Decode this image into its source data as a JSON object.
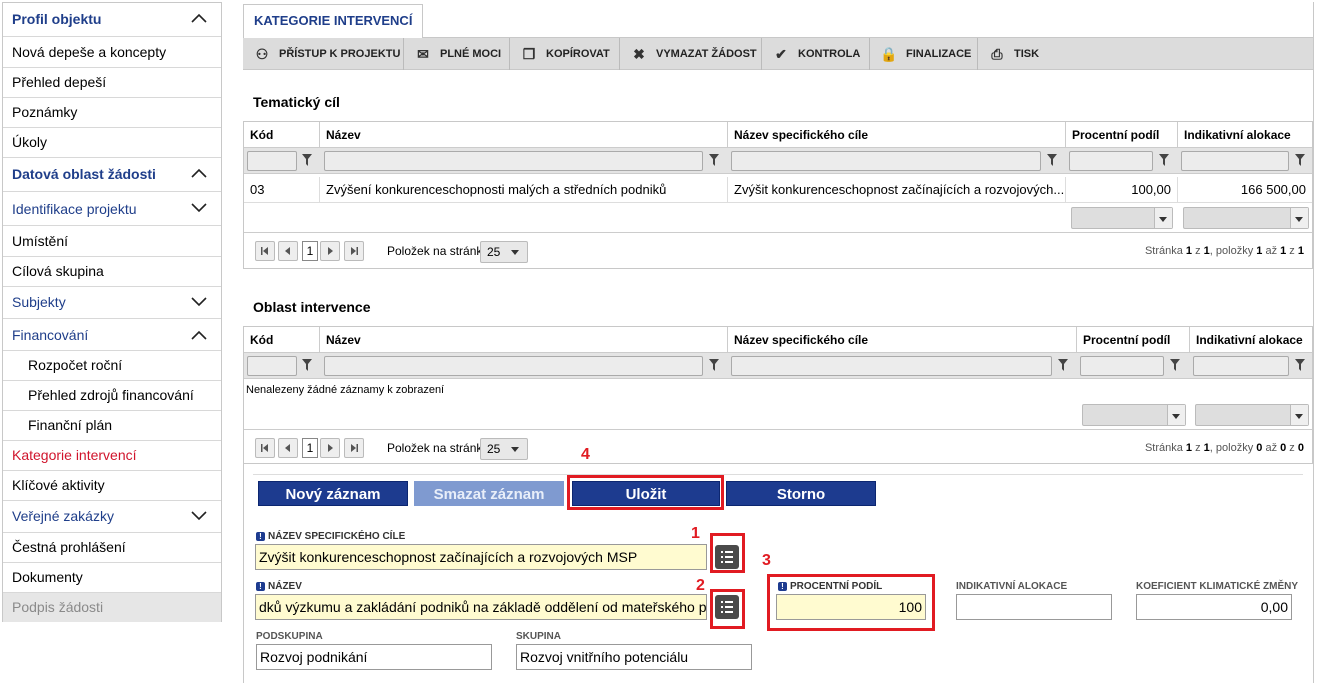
{
  "sidebar": {
    "items": [
      {
        "label": "Profil objektu"
      },
      {
        "label": "Nová depeše a koncepty"
      },
      {
        "label": "Přehled depeší"
      },
      {
        "label": "Poznámky"
      },
      {
        "label": "Úkoly"
      },
      {
        "label": "Datová oblast žádosti"
      },
      {
        "label": "Identifikace projektu"
      },
      {
        "label": "Umístění"
      },
      {
        "label": "Cílová skupina"
      },
      {
        "label": "Subjekty"
      },
      {
        "label": "Financování"
      },
      {
        "label": "Rozpočet roční"
      },
      {
        "label": "Přehled zdrojů financování"
      },
      {
        "label": "Finanční plán"
      },
      {
        "label": "Kategorie intervencí"
      },
      {
        "label": "Klíčové aktivity"
      },
      {
        "label": "Veřejné zakázky"
      },
      {
        "label": "Čestná prohlášení"
      },
      {
        "label": "Dokumenty"
      },
      {
        "label": "Podpis žádosti"
      }
    ]
  },
  "tab": {
    "label": "KATEGORIE INTERVENCÍ"
  },
  "toolbar": {
    "access": "PŘÍSTUP K PROJEKTU",
    "powers": "PLNÉ MOCI",
    "copy": "KOPÍROVAT",
    "delete": "VYMAZAT ŽÁDOST",
    "check": "KONTROLA",
    "finalize": "FINALIZACE",
    "print": "TISK"
  },
  "tematicky": {
    "title": "Tematický cíl",
    "headers": [
      "Kód",
      "Název",
      "Název specifického cíle",
      "Procentní podíl",
      "Indikativní alokace"
    ],
    "row": {
      "kod": "03",
      "nazev": "Zvýšení konkurenceschopnosti malých a středních podniků",
      "cil": "Zvýšit konkurenceschopnost začínajících a rozvojových...",
      "podil": "100,00",
      "alokace": "166 500,00"
    },
    "pager": {
      "page": "1",
      "per_page_label": "Položek na stránku",
      "per_page": "25",
      "info_a": "Stránka ",
      "p": "1",
      "info_b": " z ",
      "total": "1",
      "info_c": ", položky ",
      "from": "1",
      "info_d": " až ",
      "to": "1",
      "info_e": " z ",
      "count": "1"
    }
  },
  "oblast": {
    "title": "Oblast intervence",
    "headers": [
      "Kód",
      "Název",
      "Název specifického cíle",
      "Procentní podíl",
      "Indikativní alokace"
    ],
    "empty": "Nenalezeny žádné záznamy k zobrazení",
    "pager": {
      "page": "1",
      "per_page_label": "Položek na stránku",
      "per_page": "25",
      "info_a": "Stránka ",
      "p": "1",
      "info_b": " z ",
      "total": "1",
      "info_c": ", položky ",
      "from": "0",
      "info_d": " až ",
      "to": "0",
      "info_e": " z ",
      "count": "0"
    }
  },
  "buttons": {
    "new": "Nový záznam",
    "delete": "Smazat záznam",
    "save": "Uložit",
    "cancel": "Storno"
  },
  "form": {
    "spec_label": "NÁZEV SPECIFICKÉHO CÍLE",
    "spec_value": "Zvýšit konkurenceschopnost začínajících a rozvojových MSP",
    "name_label": "NÁZEV",
    "name_value": "dků výzkumu a zakládání podniků na základě oddělení od mateřského podniku)",
    "percent_label": "PROCENTNÍ PODÍL",
    "percent_value": "100",
    "alloc_label": "INDIKATIVNÍ ALOKACE",
    "alloc_value": "",
    "climate_label": "KOEFICIENT KLIMATICKÉ ZMĚNY",
    "climate_value": "0,00",
    "subgroup_label": "PODSKUPINA",
    "subgroup_value": "Rozvoj podnikání",
    "group_label": "SKUPINA",
    "group_value": "Rozvoj vnitřního potenciálu"
  },
  "annotations": {
    "n1": "1",
    "n2": "2",
    "n3": "3",
    "n4": "4"
  },
  "colors": {
    "accent": "#1d3b8f",
    "active": "#d0142c",
    "annotation": "#e11b22",
    "required_bg": "#fffbd0"
  }
}
